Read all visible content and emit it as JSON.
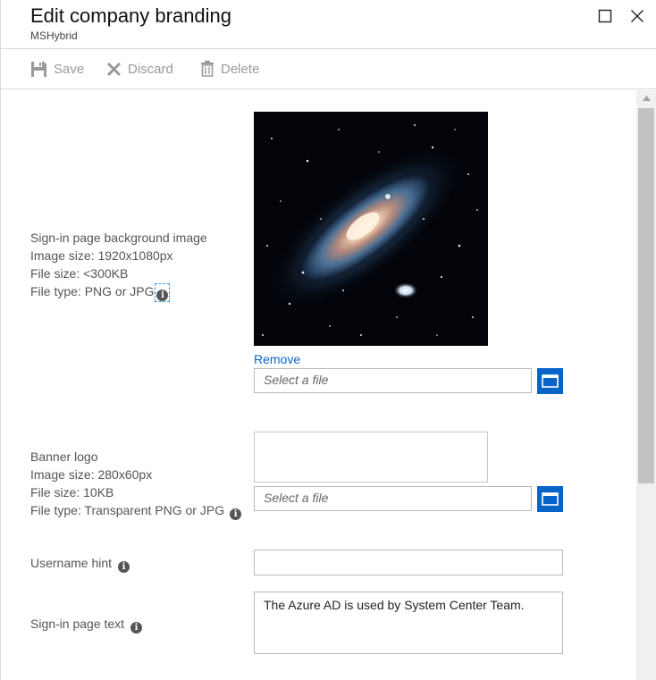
{
  "header": {
    "title": "Edit company branding",
    "subtitle": "MSHybrid",
    "maximize_icon": "maximize-icon",
    "close_icon": "close-icon"
  },
  "toolbar": {
    "save_label": "Save",
    "discard_label": "Discard",
    "delete_label": "Delete",
    "disabled_color": "#9a9a9a"
  },
  "background_image": {
    "lines": [
      "Sign-in page background image",
      "Image size: 1920x1080px",
      "File size: <300KB",
      "File type: PNG or JPG"
    ],
    "remove_label": "Remove",
    "file_placeholder": "Select a file",
    "preview": "galaxy image"
  },
  "banner_logo": {
    "lines": [
      "Banner logo",
      "Image size: 280x60px",
      "File size: 10KB",
      "File type: Transparent PNG or JPG"
    ],
    "file_placeholder": "Select a file"
  },
  "username_hint": {
    "label": "Username hint",
    "value": ""
  },
  "signin_text": {
    "label": "Sign-in page text",
    "value": "The Azure AD is used by System Center Team."
  },
  "colors": {
    "accent": "#0a64c8",
    "link": "#0a64c8",
    "border": "#b8b8b8"
  }
}
